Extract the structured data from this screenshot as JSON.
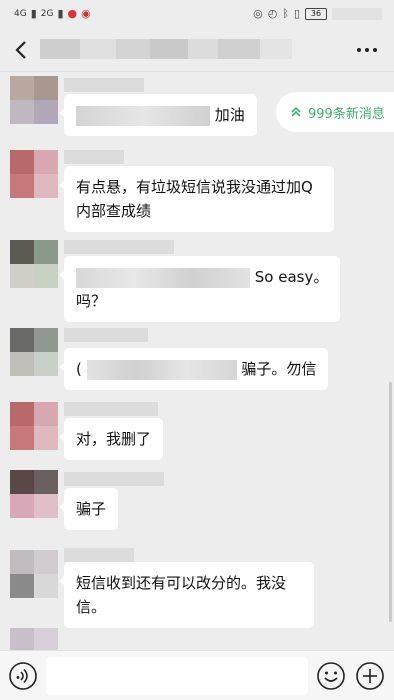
{
  "status_bar": {
    "signal_1": "4G",
    "signal_2": "2G",
    "battery": "36"
  },
  "nav": {
    "back_icon": "chevron-left-icon",
    "more_icon": "more-dots-icon"
  },
  "new_messages": {
    "icon": "double-chevron-up-icon",
    "label": "999条新消息"
  },
  "messages": [
    {
      "text": "加油"
    },
    {
      "text": "有点悬，有垃圾短信说我没通过加Q内部查成绩"
    },
    {
      "text_1": "So easy。",
      "text_2": "吗？"
    },
    {
      "prefix": "(",
      "text": "骗子。勿信"
    },
    {
      "text": "对，我删了"
    },
    {
      "text": "骗子"
    },
    {
      "text": "短信收到还有可以改分的。我没信。"
    }
  ],
  "input_bar": {
    "voice_icon": "voice-icon",
    "emoji_icon": "emoji-icon",
    "plus_icon": "plus-icon"
  },
  "colors": {
    "background": "#ededed",
    "bubble": "#ffffff",
    "accent_green": "#3db26a"
  }
}
